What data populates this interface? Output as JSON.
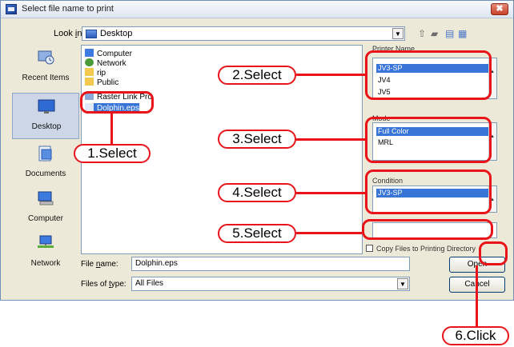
{
  "window": {
    "title": "Select file name to print",
    "close_glyph": "✖"
  },
  "lookin": {
    "label": "Look in:",
    "label_underline": "i",
    "value": "Desktop"
  },
  "toolbar_icons": [
    "up-folder-icon",
    "new-folder-icon",
    "list-view-icon",
    "details-view-icon"
  ],
  "places": [
    {
      "label": "Recent Items",
      "icon": "recent-items-icon"
    },
    {
      "label": "Desktop",
      "icon": "desktop-icon"
    },
    {
      "label": "Documents",
      "icon": "documents-icon"
    },
    {
      "label": "Computer",
      "icon": "computer-icon"
    },
    {
      "label": "Network",
      "icon": "network-icon"
    }
  ],
  "files": [
    {
      "name": "Computer"
    },
    {
      "name": "Network"
    },
    {
      "name": "rip"
    },
    {
      "name": "Public"
    },
    {
      "name": "Raster Link Pro"
    },
    {
      "name": "Dolphin.eps"
    }
  ],
  "printer_name": {
    "label": "Printer Name",
    "items": [
      "JV3-SP",
      "JV4",
      "JV5"
    ],
    "selected": "JV3-SP"
  },
  "mode": {
    "label": "Mode",
    "items": [
      "Full Color",
      "MRL"
    ],
    "selected": "Full Color"
  },
  "condition": {
    "label": "Condition",
    "items": [
      "JV3-SP"
    ],
    "selected": "JV3-SP"
  },
  "copy_option": {
    "label": "Copy Files to Printing Directory"
  },
  "file_name": {
    "label": "File name:",
    "value": "Dolphin.eps"
  },
  "file_type": {
    "label": "Files of type:",
    "value": "All Files"
  },
  "buttons": {
    "open": "Open",
    "cancel": "Cancel"
  },
  "annotations": {
    "a1": "1.Select",
    "a2": "2.Select",
    "a3": "3.Select",
    "a4": "4.Select",
    "a5": "5.Select",
    "a6": "6.Click"
  },
  "colors": {
    "annotation": "#e8141a",
    "selection": "#3875d7"
  }
}
